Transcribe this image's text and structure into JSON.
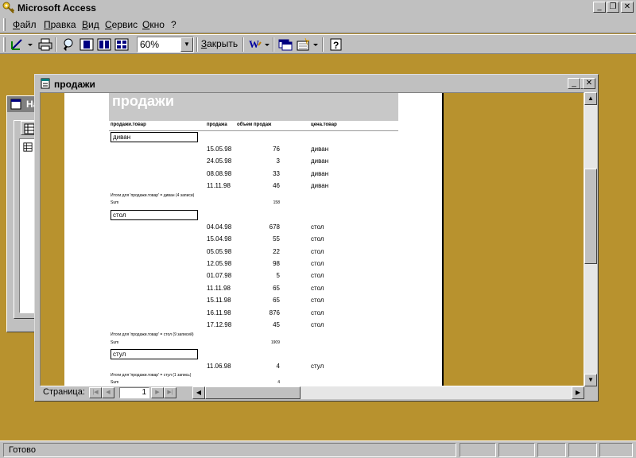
{
  "app": {
    "title": "Microsoft Access"
  },
  "menu": {
    "items": [
      "Файл",
      "Правка",
      "Вид",
      "Сервис",
      "Окно",
      "?"
    ]
  },
  "toolbar": {
    "zoom": "60%",
    "close_label": "Закрыть"
  },
  "db_window": {
    "title": "На"
  },
  "report_window": {
    "title": "продажи"
  },
  "report": {
    "title": "продажи",
    "columns": [
      "продажи.товар",
      "продажа",
      "объем продаж",
      "цена.товар"
    ],
    "groups": [
      {
        "name": "диван",
        "rows": [
          {
            "date": "15.05.98",
            "qty": "76",
            "product": "диван"
          },
          {
            "date": "24.05.98",
            "qty": "3",
            "product": "диван"
          },
          {
            "date": "08.08.98",
            "qty": "33",
            "product": "диван"
          },
          {
            "date": "11.11.98",
            "qty": "46",
            "product": "диван"
          }
        ],
        "summary": "Итоги для 'продажи.товар' = диван (4 записи)",
        "sum_label": "Sum",
        "sum_value": "158"
      },
      {
        "name": "стол",
        "rows": [
          {
            "date": "04.04.98",
            "qty": "678",
            "product": "стол"
          },
          {
            "date": "15.04.98",
            "qty": "55",
            "product": "стол"
          },
          {
            "date": "05.05.98",
            "qty": "22",
            "product": "стол"
          },
          {
            "date": "12.05.98",
            "qty": "98",
            "product": "стол"
          },
          {
            "date": "01.07.98",
            "qty": "5",
            "product": "стол"
          },
          {
            "date": "11.11.98",
            "qty": "65",
            "product": "стол"
          },
          {
            "date": "15.11.98",
            "qty": "65",
            "product": "стол"
          },
          {
            "date": "16.11.98",
            "qty": "876",
            "product": "стол"
          },
          {
            "date": "17.12.98",
            "qty": "45",
            "product": "стол"
          }
        ],
        "summary": "Итоги для 'продажи.товар' = стол (9 записей)",
        "sum_label": "Sum",
        "sum_value": "1909"
      },
      {
        "name": "стул",
        "rows": [
          {
            "date": "11.06.98",
            "qty": "4",
            "product": "стул"
          }
        ],
        "summary": "Итоги для 'продажи.товар' = стул (1 запись)",
        "sum_label": "Sum",
        "sum_value": "4"
      }
    ]
  },
  "navigation": {
    "page_label": "Страница:",
    "page_number": "1"
  },
  "status": {
    "text": "Готово"
  },
  "colors": {
    "workspace": "#b8922e",
    "chrome": "#c0c0c0",
    "header_band": "#c8c8c8"
  }
}
